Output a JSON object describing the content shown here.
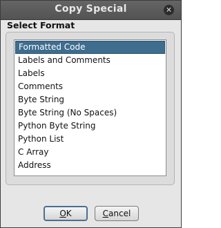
{
  "window": {
    "title": "Copy Special",
    "close_symbol": "✕"
  },
  "group": {
    "title": "Select Format"
  },
  "formats": [
    {
      "label": "Formatted Code",
      "selected": true
    },
    {
      "label": "Labels and Comments",
      "selected": false
    },
    {
      "label": "Labels",
      "selected": false
    },
    {
      "label": "Comments",
      "selected": false
    },
    {
      "label": "Byte String",
      "selected": false
    },
    {
      "label": "Byte String (No Spaces)",
      "selected": false
    },
    {
      "label": "Python Byte String",
      "selected": false
    },
    {
      "label": "Python List",
      "selected": false
    },
    {
      "label": "C Array",
      "selected": false
    },
    {
      "label": "Address",
      "selected": false
    }
  ],
  "buttons": {
    "ok": {
      "mnemonic": "O",
      "rest": "K"
    },
    "cancel": {
      "mnemonic": "C",
      "rest": "ancel"
    }
  },
  "colors": {
    "selection": "#3e6d8e",
    "titlebar": "#5b5b5b"
  }
}
